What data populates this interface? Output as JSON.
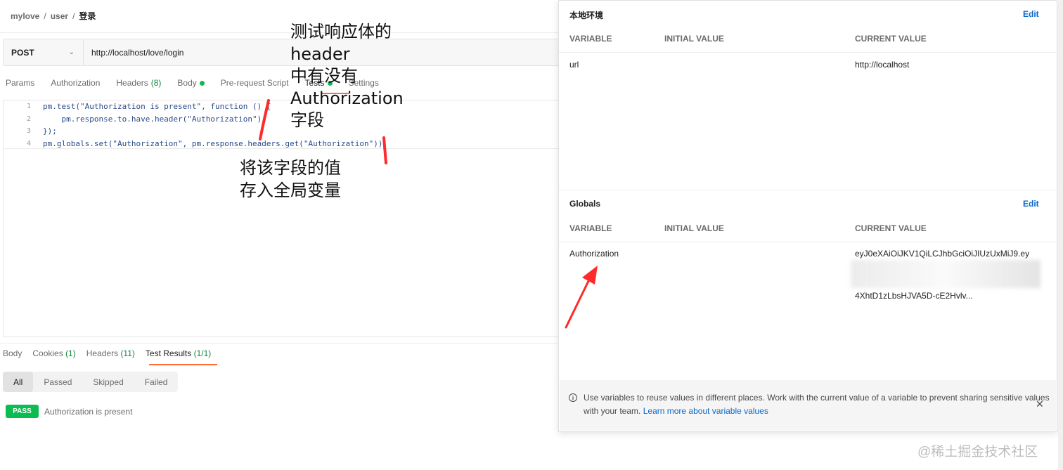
{
  "breadcrumb": {
    "items": [
      "mylove",
      "user"
    ],
    "current": "登录",
    "separator": "/"
  },
  "request": {
    "method": "POST",
    "url": "http://localhost/love/login"
  },
  "request_tabs": [
    {
      "label": "Params"
    },
    {
      "label": "Authorization"
    },
    {
      "label": "Headers",
      "count": "(8)"
    },
    {
      "label": "Body"
    },
    {
      "label": "Pre-request Script"
    },
    {
      "label": "Tests"
    },
    {
      "label": "Settings"
    }
  ],
  "code": {
    "line_numbers": [
      "1",
      "2",
      "3",
      "4"
    ],
    "lines": [
      "pm.test(\"Authorization is present\", function () {",
      "    pm.response.to.have.header(\"Authorization\");",
      "});",
      "pm.globals.set(\"Authorization\", pm.response.headers.get(\"Authorization\"));"
    ]
  },
  "response_tabs": [
    {
      "label": "Body"
    },
    {
      "label": "Cookies",
      "count": "(1)"
    },
    {
      "label": "Headers",
      "count": "(11)"
    },
    {
      "label": "Test Results",
      "count": "(1/1)"
    }
  ],
  "filters": [
    "All",
    "Passed",
    "Skipped",
    "Failed"
  ],
  "test_result": {
    "status": "PASS",
    "name": "Authorization is present"
  },
  "env_panel": {
    "env_title": "本地环境",
    "edit_label": "Edit",
    "col_variable": "VARIABLE",
    "col_initial": "INITIAL VALUE",
    "col_current": "CURRENT VALUE",
    "env_rows": [
      {
        "variable": "url",
        "initial": "",
        "current": "http://localhost"
      }
    ],
    "globals_title": "Globals",
    "globals_rows": [
      {
        "variable": "Authorization",
        "initial": "",
        "current_line1": "eyJ0eXAiOiJKV1QiLCJhbGciOiJIUzUxMiJ9.ey",
        "current_line2": "4XhtD1zLbsHJVA5D-cE2Hvlv..."
      }
    ]
  },
  "note": {
    "text": "Use variables to reuse values in different places. Work with the current value of a variable to prevent sharing sensitive values with your team.",
    "link": "Learn more about variable values"
  },
  "annotations": {
    "top": "测试响应体的\nheader\n中有没有\nAuthorization\n字段",
    "bottom": "将该字段的值\n存入全局变量"
  },
  "watermark": "@稀土掘金技术社区",
  "colors": {
    "accent": "#ff6c37",
    "pass": "#0cbb52",
    "link": "#0b68c9",
    "annotation_red": "#ff2a2a"
  }
}
